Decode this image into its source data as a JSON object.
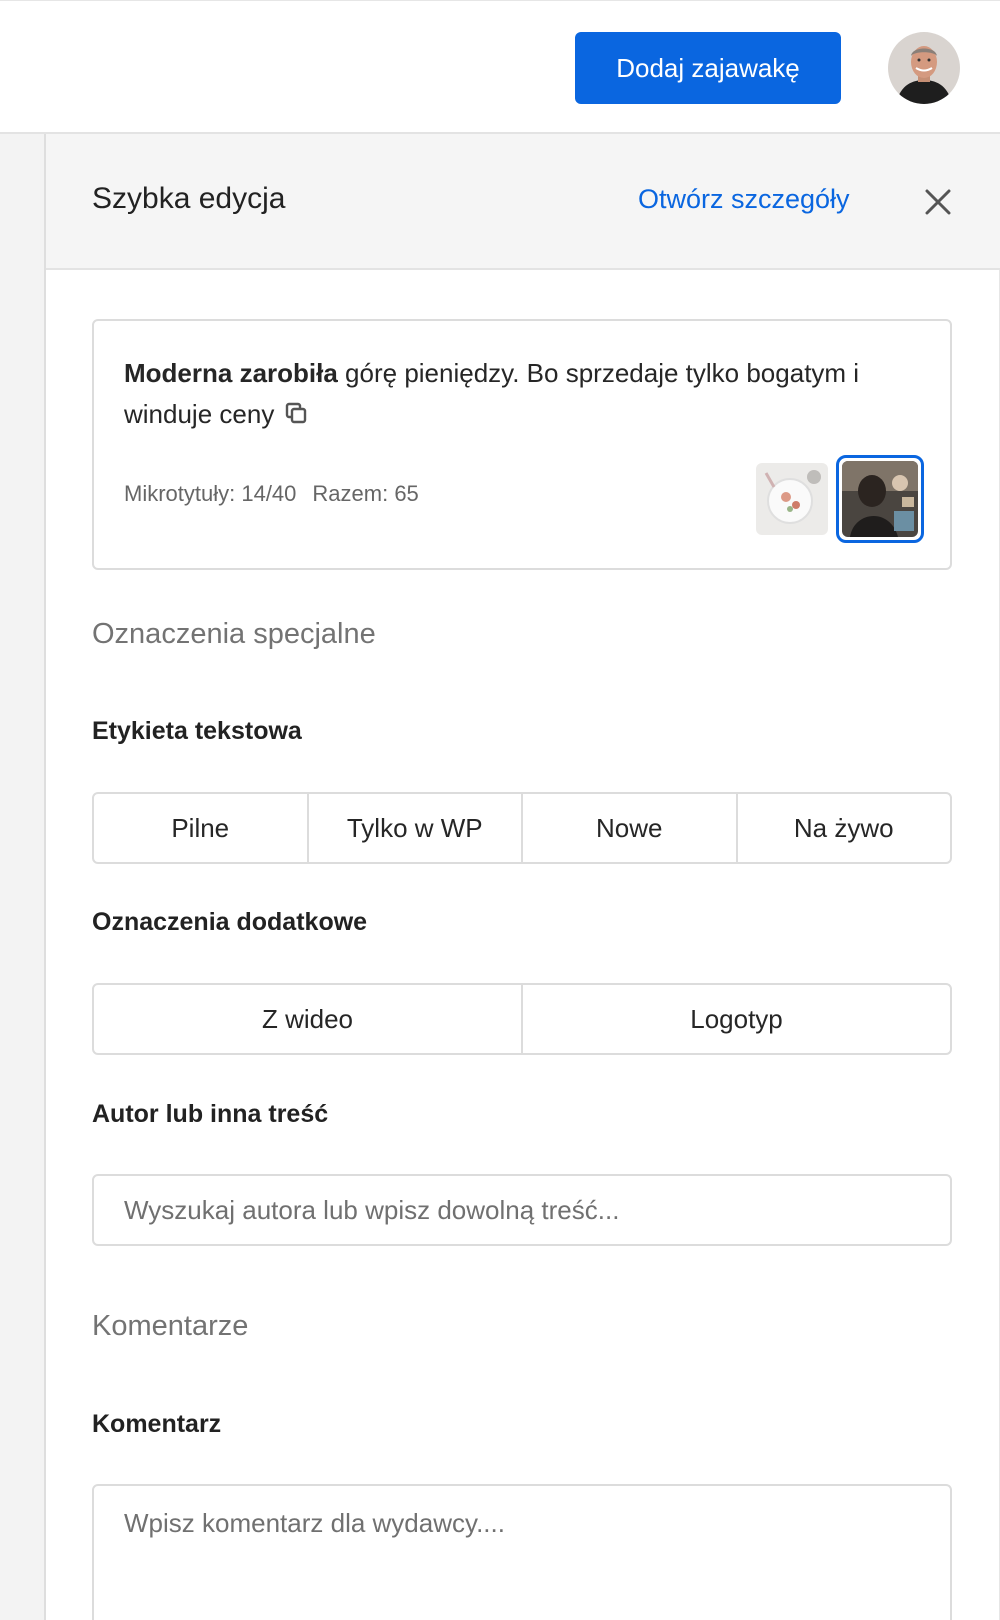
{
  "topbar": {
    "add_button": "Dodaj zajawakę",
    "avatar_alt": "user-avatar"
  },
  "panel": {
    "title": "Szybka edycja",
    "open_details": "Otwórz szczegóły",
    "close_icon": "close-icon"
  },
  "card": {
    "headline_bold": "Moderna zarobiła",
    "headline_rest": " górę pieniędzy. Bo sprzedaje tylko bogatym i winduje ceny",
    "micro_titles": "Mikrotytuły: 14/40",
    "total": "Razem: 65",
    "thumbnails": [
      {
        "name": "food-photo-thumbnail",
        "selected": false
      },
      {
        "name": "people-photo-thumbnail",
        "selected": true
      }
    ]
  },
  "special_marks": {
    "section_title": "Oznaczenia specjalne",
    "text_label": {
      "label": "Etykieta tekstowa",
      "options": [
        "Pilne",
        "Tylko w WP",
        "Nowe",
        "Na żywo"
      ]
    },
    "extra_marks": {
      "label": "Oznaczenia dodatkowe",
      "options": [
        "Z wideo",
        "Logotyp"
      ]
    },
    "author": {
      "label": "Autor lub inna treść",
      "placeholder": "Wyszukaj autora lub wpisz dowolną treść..."
    }
  },
  "comments": {
    "section_title": "Komentarze",
    "comment": {
      "label": "Komentarz",
      "placeholder": "Wpisz komentarz dla wydawcy...."
    }
  },
  "colors": {
    "accent": "#0a66e0",
    "border": "#dcdcdc",
    "header_bg": "#f5f5f5"
  }
}
